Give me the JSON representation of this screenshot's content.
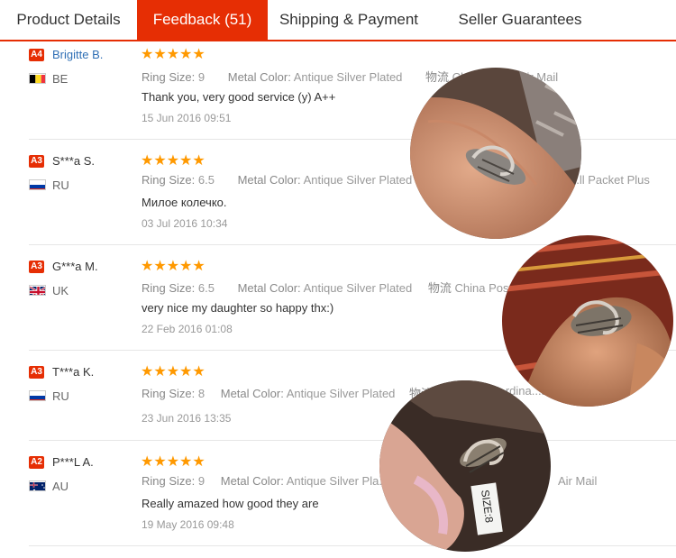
{
  "tabs": [
    {
      "label": "Product Details"
    },
    {
      "label": "Feedback (51)"
    },
    {
      "label": "Shipping & Payment"
    },
    {
      "label": "Seller Guarantees"
    }
  ],
  "stars": "★★★★★",
  "attr_keys": {
    "ring_size": "Ring Size:",
    "metal_color": "Metal Color:",
    "logistics": "物流"
  },
  "reviews": [
    {
      "level": "A4",
      "name": "Brigitte B.",
      "country": "BE",
      "ring_size": "9",
      "metal_color": "Antique Silver Plated",
      "logistics": "China",
      "logistics_tail": "...red Air Mail",
      "text": "Thank you, very good service (y) A++",
      "date": "15 Jun 2016 09:51"
    },
    {
      "level": "A3",
      "name": "S***a S.",
      "country": "RU",
      "ring_size": "6.5",
      "metal_color": "Antique Silver Plated",
      "logistics_tail": "...ll Packet Plus",
      "text": "Милое колечко.",
      "date": "03 Jul 2016 10:34"
    },
    {
      "level": "A3",
      "name": "G***a M.",
      "country": "UK",
      "ring_size": "6.5",
      "metal_color": "Antique Silver Plated",
      "logistics": "China Post",
      "text": "very nice my daughter so happy thx:)",
      "date": "22 Feb 2016 01:08"
    },
    {
      "level": "A3",
      "name": "T***a K.",
      "country": "RU",
      "ring_size": "8",
      "metal_color": "Antique Silver Plated",
      "logistics_tail": "...rdina...s",
      "text": "",
      "date": "23 Jun 2016 13:35"
    },
    {
      "level": "A2",
      "name": "P***L A.",
      "country": "AU",
      "ring_size": "9",
      "metal_color": "Antique Silver Pla...",
      "logistics_tail": "Air Mail",
      "text": "Really amazed how good they are",
      "date": "19 May 2016 09:48"
    }
  ],
  "photo_tag": "SIZE:8",
  "colors": {
    "accent": "#e62e04",
    "star": "#ff9900",
    "link": "#2f6fb5"
  }
}
